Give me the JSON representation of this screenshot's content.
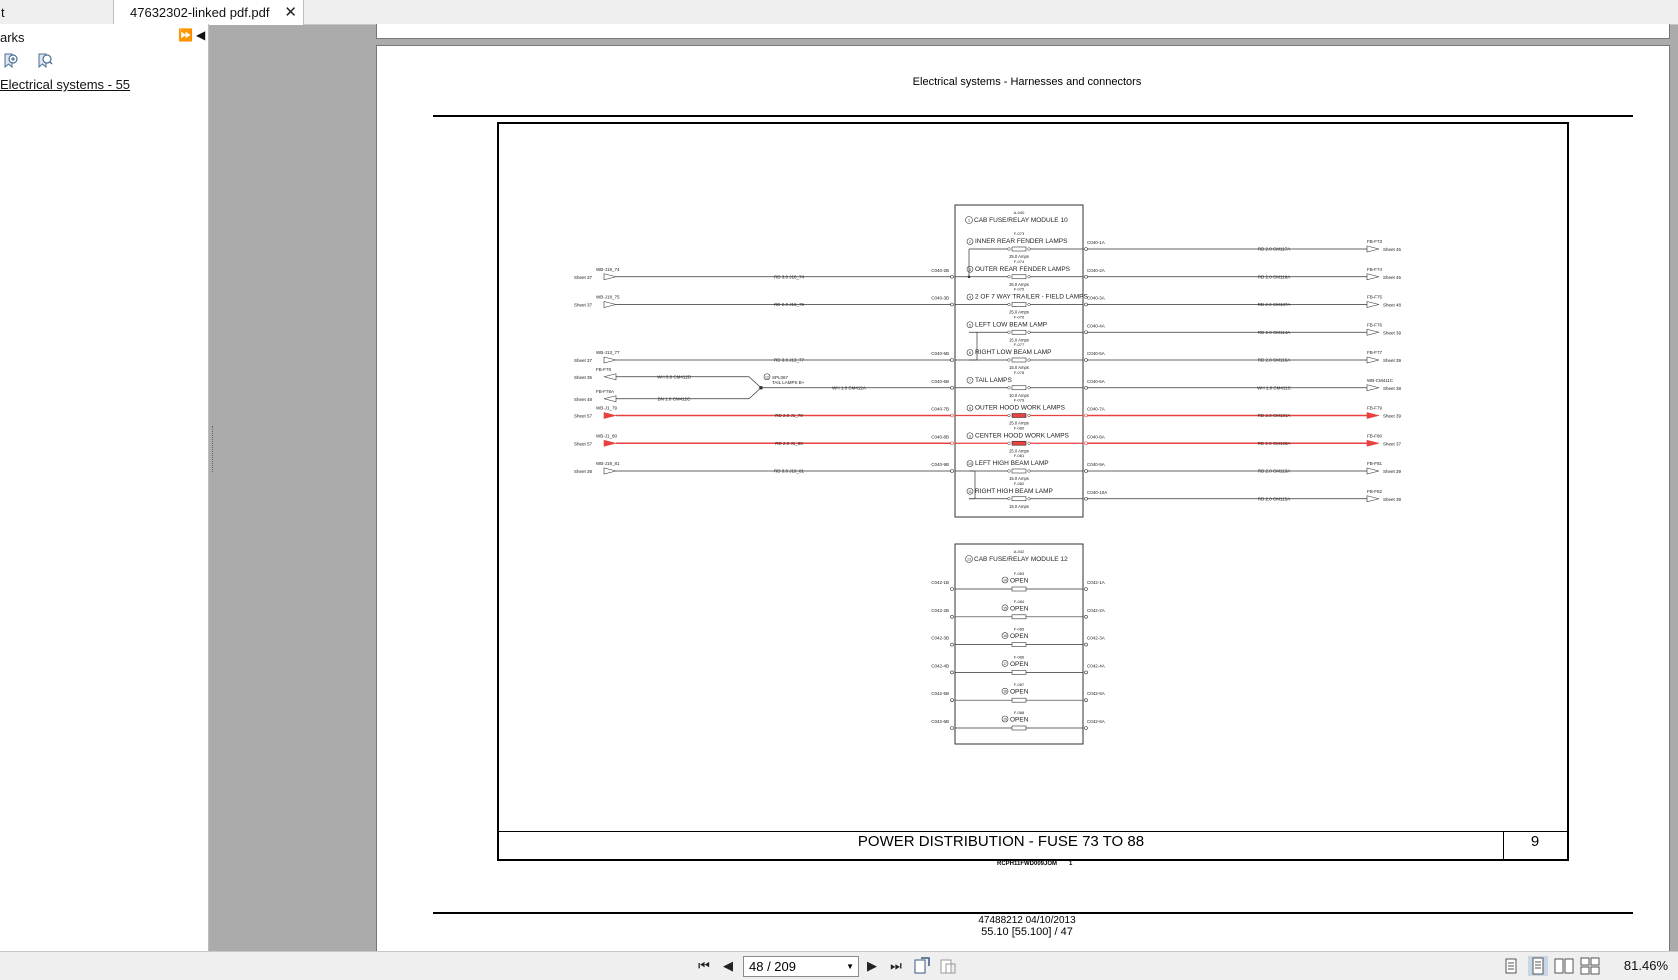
{
  "tabs": [
    {
      "label": "t"
    },
    {
      "label": "47632302-linked pdf.pdf",
      "close": "✕"
    }
  ],
  "sidebar": {
    "title": "arks",
    "expand_all": "⏩",
    "collapse": "◀",
    "bookmark": "Electrical systems - 55"
  },
  "page": {
    "header": "Electrical systems - Harnesses and connectors",
    "footer_line1": "47488212 04/10/2013",
    "footer_line2": "55.10 [55.100] / 47"
  },
  "drawing": {
    "title": "POWER DISTRIBUTION - FUSE 73 TO 88",
    "sheet": "9",
    "doc_code": "RCPH11FWD009JOM",
    "doc_index": "1"
  },
  "module10": {
    "id": "A-040",
    "num": "1",
    "title": "CAB FUSE/RELAY MODULE 10",
    "fuses": [
      {
        "id": "F-073",
        "num": "2",
        "label": "INNER REAR FENDER LAMPS",
        "amps": "25.0 Amps",
        "in_pin": "",
        "out_pin": "C040-1A",
        "out_wire": "RD 2.0 CM117A",
        "out_conn": "FB-F73",
        "out_sheet": "Sheet 45",
        "hot": false
      },
      {
        "id": "F-074",
        "num": "3",
        "label": "OUTER REAR FENDER LAMPS",
        "amps": "25.0 Amps",
        "in_src": "WB-J18_74",
        "in_sheet": "Sheet 37",
        "in_wire": "RD 3.0 J18_74",
        "in_pin": "C040-2B",
        "out_pin": "C040-2A",
        "out_wire": "RD 2.0 CM118A",
        "out_conn": "FB-F74",
        "out_sheet": "Sheet 45",
        "hot": false
      },
      {
        "id": "F-075",
        "num": "4",
        "label": "2 OF 7 WAY TRAILER - FIELD LAMPS",
        "amps": "25.0 Amps",
        "in_src": "WB-J18_75",
        "in_sheet": "Sheet 37",
        "in_wire": "RD 2.0 J18_75",
        "in_pin": "C040-3B",
        "out_pin": "C040-3A",
        "out_wire": "RD 2.0 CM137A",
        "out_conn": "FB-F75",
        "out_sheet": "Sheet 48",
        "hot": false
      },
      {
        "id": "F-076",
        "num": "5",
        "label": "LEFT LOW BEAM LAMP",
        "amps": "15.0 Amps",
        "in_pin": "",
        "out_pin": "C040-4A",
        "out_wire": "RD 2.0 CM114A",
        "out_conn": "FB-F76",
        "out_sheet": "Sheet 39",
        "hot": false
      },
      {
        "id": "F-077",
        "num": "6",
        "label": "RIGHT LOW BEAM LAMP",
        "amps": "15.0 Amps",
        "in_src": "WB-J13_77",
        "in_sheet": "Sheet 37",
        "in_wire": "RD 3.0 J13_77",
        "in_pin": "C040-5B",
        "out_pin": "C040-5A",
        "out_wire": "RD 2.0 CM116A",
        "out_conn": "FB-F77",
        "out_sheet": "Sheet 39",
        "hot": false
      },
      {
        "id": "F-078",
        "num": "7",
        "label": "TAIL LAMPS",
        "amps": "10.0 Amps",
        "in_wire": "WH 1.0 CM412A",
        "in_pin": "C040-6B",
        "out_pin": "C040-6A",
        "out_wire": "WH 1.0 CM411C",
        "out_conn": "WB-CM411C",
        "out_sheet": "Sheet 38",
        "hot": false
      },
      {
        "id": "F-079",
        "num": "8",
        "label": "OUTER HOOD WORK LAMPS",
        "amps": "25.0 Amps",
        "in_src": "WB-J1_79",
        "in_sheet": "Sheet 57",
        "in_wire": "RD 2.0 J1_79",
        "in_pin": "C040-7B",
        "out_pin": "C040-7A",
        "out_wire": "RD 2.0 CM121A",
        "out_conn": "FB-F79",
        "out_sheet": "Sheet 39",
        "hot": true
      },
      {
        "id": "F-080",
        "num": "9",
        "label": "CENTER HOOD WORK LAMPS",
        "amps": "25.0 Amps",
        "in_src": "WB-J1_80",
        "in_sheet": "Sheet 57",
        "in_wire": "RD 2.0 J1_80",
        "in_pin": "C040-8B",
        "out_pin": "C040-8A",
        "out_wire": "RD 2.0 CM126A",
        "out_conn": "FB-F80",
        "out_sheet": "Sheet 37",
        "hot": true
      },
      {
        "id": "F-081",
        "num": "10",
        "label": "LEFT HIGH BEAM LAMP",
        "amps": "15.0 Amps",
        "in_src": "WB-J19_81",
        "in_sheet": "Sheet 38",
        "in_wire": "RD 3.0 J19_81",
        "in_pin": "C040-9B",
        "out_pin": "C040-9A",
        "out_wire": "RD 2.0 CM113A",
        "out_conn": "FB-F81",
        "out_sheet": "Sheet 39",
        "hot": false
      },
      {
        "id": "F-082",
        "num": "11",
        "label": "RIGHT HIGH BEAM LAMP",
        "amps": "15.0 Amps",
        "in_pin": "",
        "out_pin": "C040-10A",
        "out_wire": "RD 2.0 CM115A",
        "out_conn": "FB-F82",
        "out_sheet": "Sheet 39",
        "hot": false
      }
    ],
    "splice": {
      "num": "12",
      "id": "SPL067",
      "label": "TAIL LAMPS B+",
      "inputs": [
        {
          "conn": "FB-F78",
          "sheet": "Sheet 35",
          "wire": "WH 0.8 CM412B"
        },
        {
          "conn": "FB-F78A",
          "sheet": "Sheet 48",
          "wire": "BN 1.0 CM412C"
        }
      ]
    }
  },
  "module12": {
    "id": "A-042",
    "num": "13",
    "title": "CAB FUSE/RELAY MODULE 12",
    "fuses": [
      {
        "id": "F-083",
        "num": "14",
        "label": "OPEN",
        "in_pin": "C042-1B",
        "out_pin": "C042-1A"
      },
      {
        "id": "F-084",
        "num": "15",
        "label": "OPEN",
        "in_pin": "C042-2B",
        "out_pin": "C042-2A"
      },
      {
        "id": "F-085",
        "num": "16",
        "label": "OPEN",
        "in_pin": "C042-3B",
        "out_pin": "C042-3A"
      },
      {
        "id": "F-086",
        "num": "17",
        "label": "OPEN",
        "in_pin": "C042-4B",
        "out_pin": "C042-4A"
      },
      {
        "id": "F-087",
        "num": "18",
        "label": "OPEN",
        "in_pin": "C042-5B",
        "out_pin": "C042-5A"
      },
      {
        "id": "F-088",
        "num": "19",
        "label": "OPEN",
        "in_pin": "C042-6B",
        "out_pin": "C042-6A"
      }
    ]
  },
  "statusbar": {
    "page_value": "48 / 209",
    "zoom": "81.46%"
  },
  "colors": {
    "hot_wire": "#e8413f",
    "wire": "#333333"
  }
}
